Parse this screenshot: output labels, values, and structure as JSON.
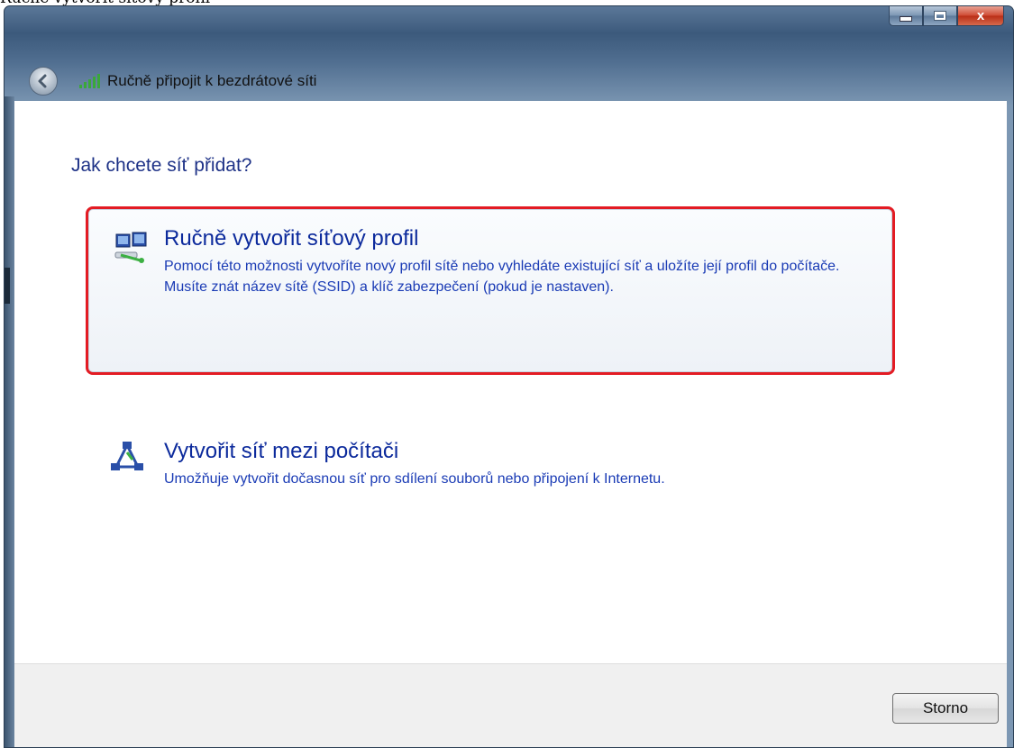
{
  "page_caption": "Ručně vytvořit síťový profil",
  "window": {
    "title": "Ručně připojit k bezdrátové síti",
    "close_glyph": "x"
  },
  "content": {
    "heading": "Jak chcete síť přidat?",
    "options": [
      {
        "title": "Ručně vytvořit síťový profil",
        "description": "Pomocí této možnosti vytvoříte nový profil sítě nebo vyhledáte existující síť a uložíte její profil do počítače. Musíte znát název sítě (SSID) a klíč zabezpečení (pokud je nastaven).",
        "icon": "network-computers-icon",
        "highlighted": true
      },
      {
        "title": "Vytvořit síť mezi počítači",
        "description": "Umožňuje vytvořit dočasnou síť pro sdílení souborů nebo připojení k Internetu.",
        "icon": "adhoc-network-icon",
        "highlighted": false
      }
    ]
  },
  "footer": {
    "cancel_label": "Storno"
  },
  "colors": {
    "highlight_border": "#e31b23",
    "link_blue": "#0c2a9c",
    "heading_blue": "#1e3287"
  }
}
